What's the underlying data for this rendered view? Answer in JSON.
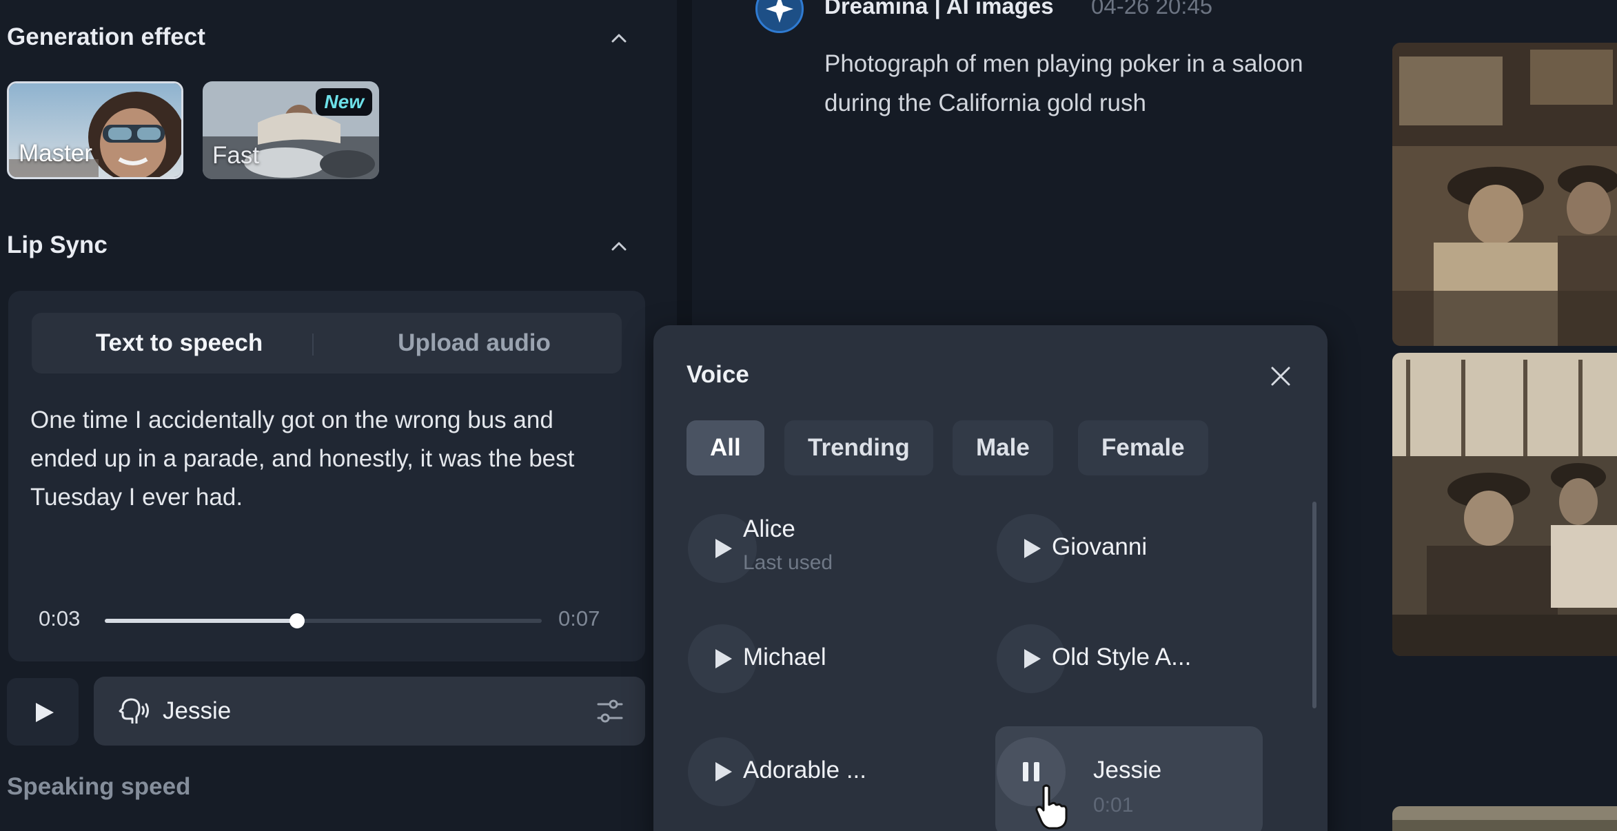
{
  "left": {
    "generation_effect": {
      "title": "Generation effect",
      "options": [
        {
          "label": "Master",
          "selected": true
        },
        {
          "label": "Fast",
          "badge": "New",
          "selected": false
        }
      ]
    },
    "lip_sync": {
      "title": "Lip Sync",
      "tabs": [
        {
          "label": "Text to speech",
          "active": true
        },
        {
          "label": "Upload audio",
          "active": false
        }
      ],
      "text": "One time I accidentally got on the wrong bus and ended up in a parade, and honestly, it was the best Tuesday I ever had.",
      "player": {
        "current": "0:03",
        "total": "0:07",
        "progress": 0.44
      }
    },
    "voice_select": {
      "name": "Jessie",
      "icon": "speaking-head-icon",
      "settings_icon": "sliders-icon"
    },
    "speaking_speed_label": "Speaking speed"
  },
  "chat": {
    "sender": "Dreamina | AI images",
    "timestamp": "04-26  20:45",
    "prompt": "Photograph of men playing poker in a saloon during the California gold rush"
  },
  "voice_popup": {
    "title": "Voice",
    "filters": [
      {
        "label": "All",
        "active": true
      },
      {
        "label": "Trending",
        "active": false
      },
      {
        "label": "Male",
        "active": false
      },
      {
        "label": "Female",
        "active": false
      }
    ],
    "voices": [
      {
        "name": "Alice",
        "sub": "Last used",
        "playing": false
      },
      {
        "name": "Giovanni",
        "sub": "",
        "playing": false
      },
      {
        "name": "Michael",
        "sub": "",
        "playing": false
      },
      {
        "name": "Old Style A...",
        "sub": "",
        "playing": false
      },
      {
        "name": "Adorable ...",
        "sub": "",
        "playing": false
      },
      {
        "name": "Jessie",
        "sub": "0:01",
        "playing": true
      }
    ]
  },
  "colors": {
    "background": "#151b25",
    "panel": "#202733",
    "popup": "#2a313d",
    "accent_cyan": "#6de0e8"
  }
}
